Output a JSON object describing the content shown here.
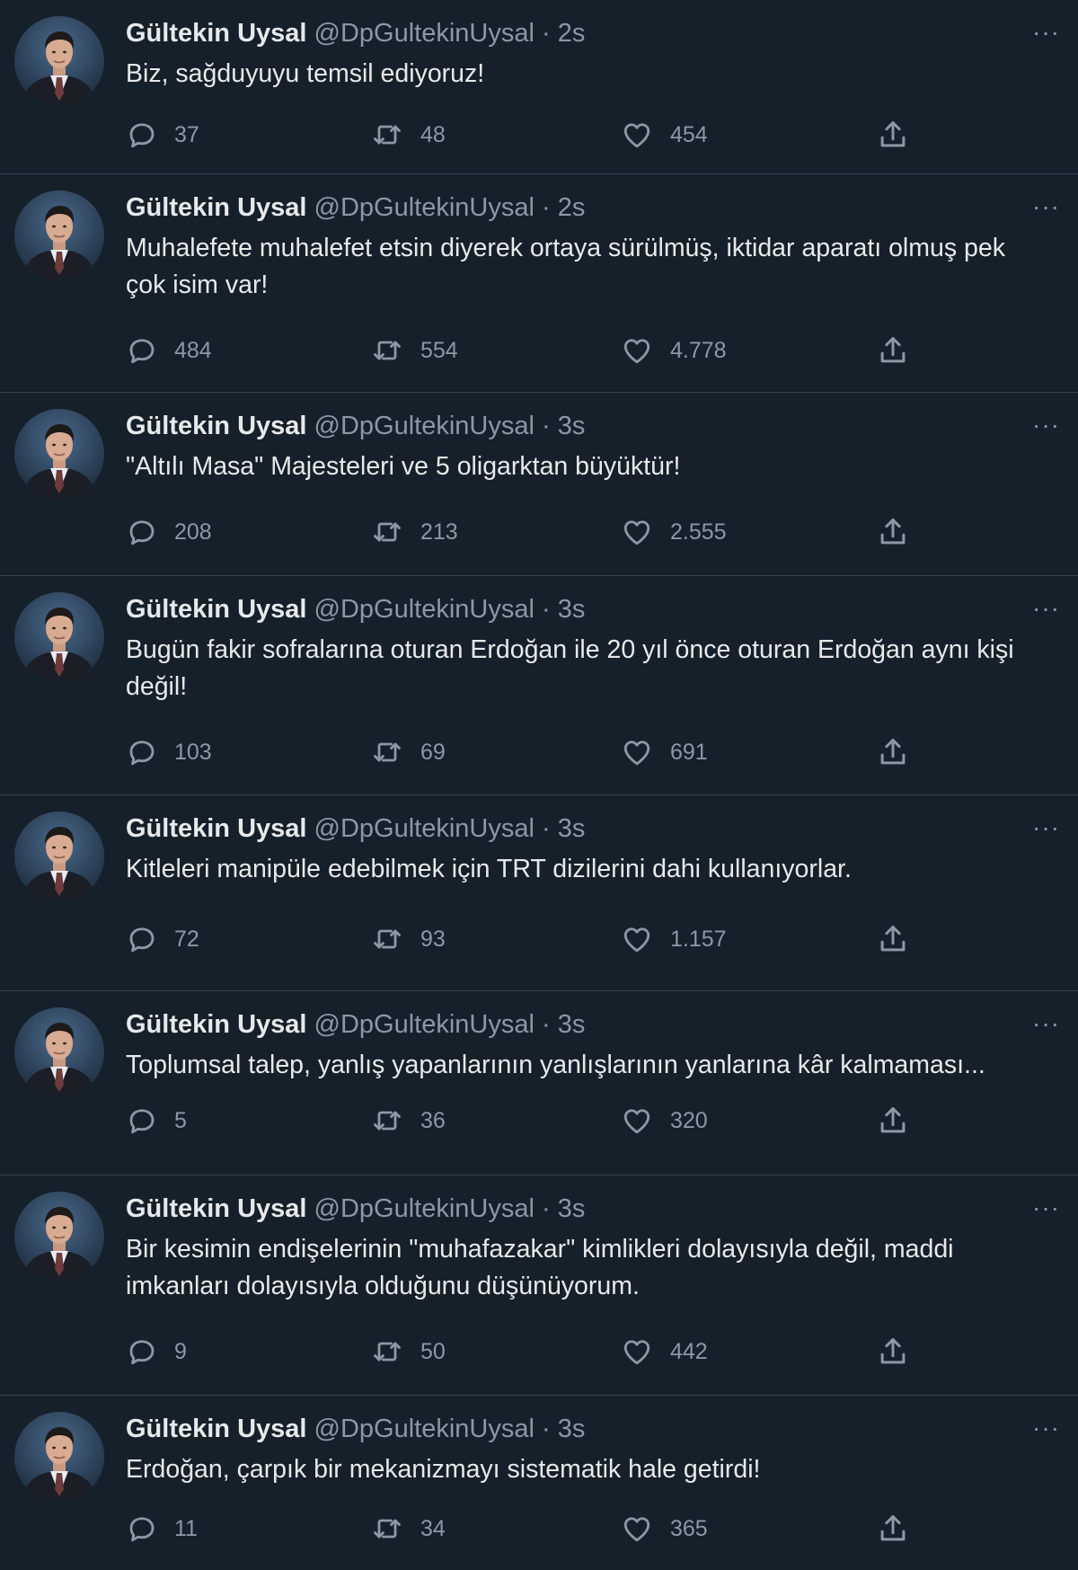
{
  "author": {
    "name": "Gültekin Uysal",
    "handle": "@DpGultekinUysal"
  },
  "separator": "·",
  "more_label": "···",
  "icons": {
    "avatar": "avatar-photo",
    "more": "more-options-icon",
    "reply": "reply-icon",
    "retweet": "retweet-icon",
    "like": "heart-icon",
    "share": "share-icon"
  },
  "colors": {
    "background": "#15202b",
    "text": "#e7e9ea",
    "muted": "#8b98a5",
    "divider": "#38444d"
  },
  "tweets": [
    {
      "name": "Gültekin Uysal",
      "handle": "@DpGultekinUysal",
      "time": "2s",
      "text": "Biz, sağduyuyu temsil ediyoruz!",
      "replies": "37",
      "retweets": "48",
      "likes": "454"
    },
    {
      "name": "Gültekin Uysal",
      "handle": "@DpGultekinUysal",
      "time": "2s",
      "text": "Muhalefete muhalefet etsin diyerek ortaya sürülmüş, iktidar aparatı olmuş pek çok isim var!",
      "replies": "484",
      "retweets": "554",
      "likes": "4.778"
    },
    {
      "name": "Gültekin Uysal",
      "handle": "@DpGultekinUysal",
      "time": "3s",
      "text": "\"Altılı Masa\" Majesteleri ve 5 oligarktan büyüktür!",
      "replies": "208",
      "retweets": "213",
      "likes": "2.555"
    },
    {
      "name": "Gültekin Uysal",
      "handle": "@DpGultekinUysal",
      "time": "3s",
      "text": "Bugün fakir sofralarına oturan Erdoğan ile 20 yıl önce oturan Erdoğan aynı kişi değil!",
      "replies": "103",
      "retweets": "69",
      "likes": "691"
    },
    {
      "name": "Gültekin Uysal",
      "handle": "@DpGultekinUysal",
      "time": "3s",
      "text": "Kitleleri manipüle edebilmek için TRT dizilerini dahi kullanıyorlar.",
      "replies": "72",
      "retweets": "93",
      "likes": "1.157"
    },
    {
      "name": "Gültekin Uysal",
      "handle": "@DpGultekinUysal",
      "time": "3s",
      "text": "Toplumsal talep, yanlış yapanlarının yanlışlarının yanlarına kâr kalmaması...",
      "replies": "5",
      "retweets": "36",
      "likes": "320"
    },
    {
      "name": "Gültekin Uysal",
      "handle": "@DpGultekinUysal",
      "time": "3s",
      "text": "Bir kesimin endişelerinin \"muhafazakar\" kimlikleri dolayısıyla değil, maddi imkanları dolayısıyla olduğunu düşünüyorum.",
      "replies": "9",
      "retweets": "50",
      "likes": "442"
    },
    {
      "name": "Gültekin Uysal",
      "handle": "@DpGultekinUysal",
      "time": "3s",
      "text": "Erdoğan, çarpık bir mekanizmayı sistematik hale getirdi!",
      "replies": "11",
      "retweets": "34",
      "likes": "365"
    }
  ]
}
